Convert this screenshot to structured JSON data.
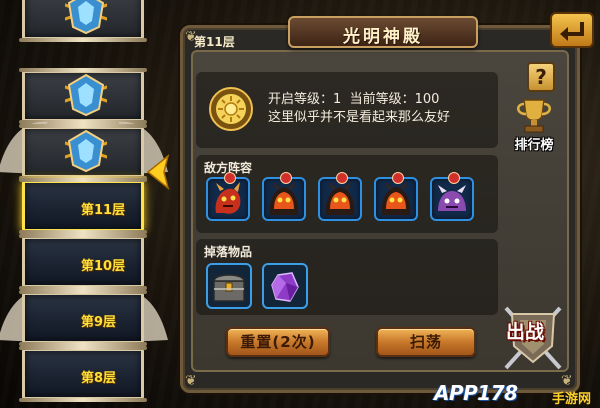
{
  "panel": {
    "title": "光明神殿",
    "floor_tag": "第11层",
    "info": {
      "open_level_label": "开启等级：",
      "open_level": "1",
      "current_level_label": "当前等级：",
      "current_level": "100",
      "description": "这里似乎并不是看起来那么友好"
    },
    "enemy_section_title": "敌方阵容",
    "enemies": [
      {
        "icon": "red-dragon-icon"
      },
      {
        "icon": "lava-golem-icon"
      },
      {
        "icon": "lava-golem-icon"
      },
      {
        "icon": "lava-golem-icon"
      },
      {
        "icon": "purple-beast-icon"
      }
    ],
    "drop_section_title": "掉落物品",
    "drops": [
      {
        "icon": "treasure-chest-icon"
      },
      {
        "icon": "purple-crystal-icon"
      }
    ],
    "reset_button": "重置(2次)",
    "sweep_button": "扫荡"
  },
  "side_buttons": {
    "help": "?",
    "rank": "排行榜",
    "battle": "出战"
  },
  "tower": {
    "floors": [
      {
        "label": "",
        "state": "locked"
      },
      {
        "label": "",
        "state": "locked"
      },
      {
        "label": "",
        "state": "locked"
      },
      {
        "label": "第11层",
        "state": "current"
      },
      {
        "label": "第10层",
        "state": "cleared"
      },
      {
        "label": "第9层",
        "state": "cleared"
      },
      {
        "label": "第8层",
        "state": "cleared"
      }
    ]
  },
  "watermark": {
    "main": "APP178",
    "sub": "手游网"
  },
  "colors": {
    "accent_gold": "#ffdf3a",
    "slot_border": "#2f8fe0",
    "button_orange": "#c7782a"
  }
}
